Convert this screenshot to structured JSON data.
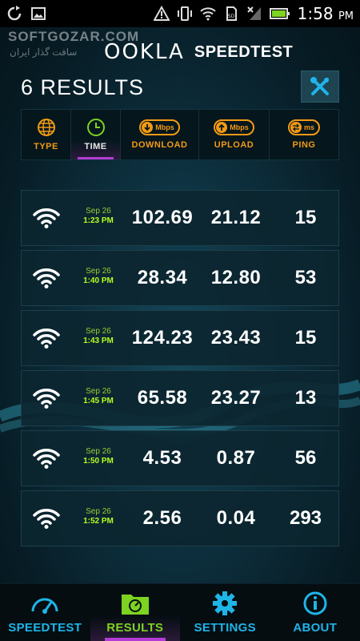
{
  "status_bar": {
    "time": "1:58",
    "ampm": "PM"
  },
  "watermark": {
    "text": "SOFTGOZAR.COM",
    "subtext": "سافت گذار ایران"
  },
  "header": {
    "brand": "OOKLA",
    "product": "SPEEDTEST",
    "results_title": "6 RESULTS"
  },
  "sort_tabs": [
    {
      "label": "TYPE",
      "icon": "globe-icon",
      "active": false
    },
    {
      "label": "TIME",
      "icon": "clock-icon",
      "active": true
    },
    {
      "label": "DOWNLOAD",
      "icon": "download-icon",
      "unit": "Mbps",
      "active": false
    },
    {
      "label": "UPLOAD",
      "icon": "upload-icon",
      "unit": "Mbps",
      "active": false
    },
    {
      "label": "PING",
      "icon": "ping-icon",
      "unit": "ms",
      "active": false
    }
  ],
  "results": [
    {
      "date": "Sep 26",
      "time": "1:23 PM",
      "download": "102.69",
      "upload": "21.12",
      "ping": "15",
      "type": "wifi"
    },
    {
      "date": "Sep 26",
      "time": "1:40 PM",
      "download": "28.34",
      "upload": "12.80",
      "ping": "53",
      "type": "wifi"
    },
    {
      "date": "Sep 26",
      "time": "1:43 PM",
      "download": "124.23",
      "upload": "23.43",
      "ping": "15",
      "type": "wifi"
    },
    {
      "date": "Sep 26",
      "time": "1:45 PM",
      "download": "65.58",
      "upload": "23.27",
      "ping": "13",
      "type": "wifi"
    },
    {
      "date": "Sep 26",
      "time": "1:50 PM",
      "download": "4.53",
      "upload": "0.87",
      "ping": "56",
      "type": "wifi"
    },
    {
      "date": "Sep 26",
      "time": "1:52 PM",
      "download": "2.56",
      "upload": "0.04",
      "ping": "293",
      "type": "wifi"
    }
  ],
  "bottom_nav": [
    {
      "label": "SPEEDTEST",
      "icon": "speedometer-icon",
      "active": false
    },
    {
      "label": "RESULTS",
      "icon": "folder-chart-icon",
      "active": true
    },
    {
      "label": "SETTINGS",
      "icon": "gear-icon",
      "active": false
    },
    {
      "label": "ABOUT",
      "icon": "info-icon",
      "active": false
    }
  ],
  "colors": {
    "accent_orange": "#f19a14",
    "accent_blue": "#1fb4e8",
    "accent_green": "#7dd321",
    "accent_purple": "#b33cd6"
  }
}
